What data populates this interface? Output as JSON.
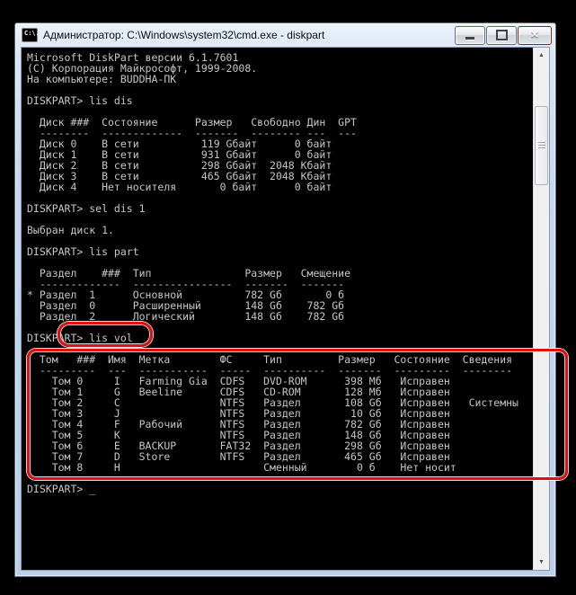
{
  "window": {
    "title": "Администратор: C:\\Windows\\system32\\cmd.exe - diskpart",
    "icon_text": "C:\\."
  },
  "icons": {
    "up_arrow": "▲",
    "down_arrow": "▼",
    "close": "✕"
  },
  "console": {
    "lines": [
      "Microsoft DiskPart версии 6.1.7601",
      "(C) Корпорация Майкрософт, 1999-2008.",
      "На компьютере: BUDDHA-ПК",
      "",
      "DISKPART> lis dis",
      "",
      "  Диск ###  Состояние      Размер   Свободно Дин  GPT",
      "  --------  -------------  -------  -------- ---  ---",
      "  Диск 0    В сети          119 Gбайт      0 байт",
      "  Диск 1    В сети          931 Gбайт      0 байт",
      "  Диск 2    В сети          298 Gбайт  2048 Кбайт",
      "  Диск 3    В сети          465 Gбайт  2048 Кбайт",
      "  Диск 4    Нет носителя       0 байт      0 байт",
      "",
      "DISKPART> sel dis 1",
      "",
      "Выбран диск 1.",
      "",
      "DISKPART> lis part",
      "",
      "  Раздел    ###  Тип               Размер   Смещение",
      "  -------------  ----------------  -------  -------",
      "* Раздел  1      Основной          782 Gб       0 б",
      "  Раздел  0      Расширенный       148 Gб    782 Gб",
      "  Раздел  2      Логический        148 Gб    782 Gб",
      "",
      "DISKPART> lis vol",
      "",
      "  Том   ###  Имя  Метка        ФС     Тип         Размер   Состояние  Сведения",
      "  ---------  ---  -----------  -----  ----------  -------  ---------  --------",
      "    Том 0     I   Farming Gia  CDFS   DVD-ROM      398 Mб   Исправен",
      "    Том 1     G   Beeline      CDFS   CD-ROM       128 Mб   Исправен",
      "    Том 2     C                NTFS   Раздел       108 Gб   Исправен   Системны",
      "    Том 3     J                NTFS   Раздел        10 Gб   Исправен",
      "    Том 4     F   Рабочий      NTFS   Раздел       782 Gб   Исправен",
      "    Том 5     K                NTFS   Раздел       148 Gб   Исправен",
      "    Том 6     E   BACKUP       FAT32  Раздел       298 Gб   Исправен",
      "    Том 7     D   Store        NTFS   Раздел       465 Gб   Исправен",
      "    Том 8     H                       Сменный        0 б    Нет носит",
      "",
      "DISKPART> _"
    ]
  },
  "annotations": {
    "color": "#e01010",
    "circled_command": "lis vol",
    "boxed_section": "volume-table"
  }
}
